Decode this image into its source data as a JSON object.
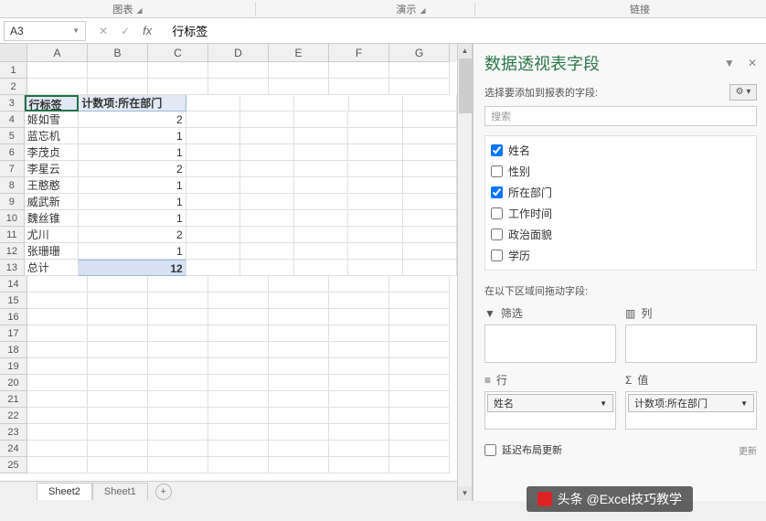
{
  "ribbon": {
    "group1": "图表",
    "group2": "演示",
    "group3": "链接"
  },
  "namebox": "A3",
  "fx_label": "fx",
  "formula": "行标签",
  "columns": [
    "A",
    "B",
    "C",
    "D",
    "E",
    "F",
    "G"
  ],
  "pivot": {
    "row_header": "行标签",
    "val_header": "计数项:所在部门",
    "rows": [
      {
        "label": "姬如雪",
        "val": 2
      },
      {
        "label": "蓝忘机",
        "val": 1
      },
      {
        "label": "李茂贞",
        "val": 1
      },
      {
        "label": "李星云",
        "val": 2
      },
      {
        "label": "王憨憨",
        "val": 1
      },
      {
        "label": "威武新",
        "val": 1
      },
      {
        "label": "魏丝锥",
        "val": 1
      },
      {
        "label": "尤川",
        "val": 2
      },
      {
        "label": "张珊珊",
        "val": 1
      }
    ],
    "total_label": "总计",
    "total_val": 12
  },
  "pane": {
    "title": "数据透视表字段",
    "sub": "选择要添加到报表的字段:",
    "search_ph": "搜索",
    "fields": [
      {
        "label": "姓名",
        "checked": true
      },
      {
        "label": "性别",
        "checked": false
      },
      {
        "label": "所在部门",
        "checked": true
      },
      {
        "label": "工作时间",
        "checked": false
      },
      {
        "label": "政治面貌",
        "checked": false
      },
      {
        "label": "学历",
        "checked": false
      }
    ],
    "areas_label": "在以下区域间拖动字段:",
    "filter": "筛选",
    "columns_area": "列",
    "rows_area": "行",
    "values_area": "值",
    "row_item": "姓名",
    "val_item": "计数项:所在部门",
    "defer": "延迟布局更新",
    "update": "更新"
  },
  "tabs": {
    "active": "Sheet2",
    "other": "Sheet1"
  },
  "watermark": "头条 @Excel技巧教学"
}
